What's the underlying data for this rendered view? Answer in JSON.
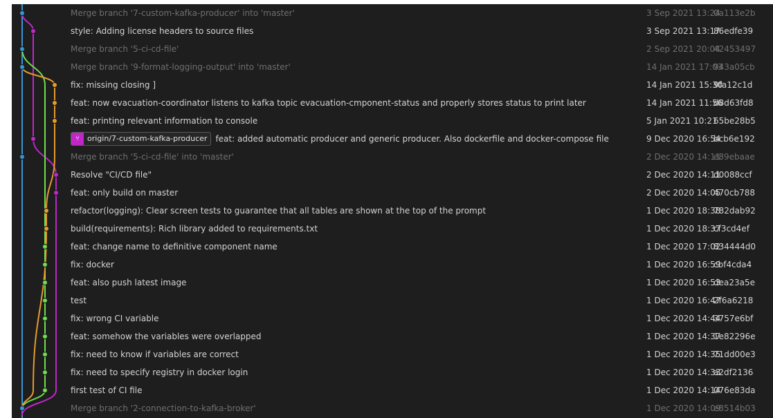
{
  "colors": {
    "blue": "#3794d6",
    "magenta": "#c026c8",
    "orange": "#e89b2c",
    "green": "#6fe04a"
  },
  "commits": [
    {
      "message": "Merge branch '7-custom-kafka-producer' into 'master'",
      "date": "3 Sep 2021 13:24",
      "hash": "0a113e2b",
      "merge": true
    },
    {
      "message": "style: Adding license headers to source files",
      "date": "3 Sep 2021 13:17",
      "hash": "86edfe39",
      "merge": false
    },
    {
      "message": "Merge branch '5-ci-cd-file'",
      "date": "2 Sep 2021 20:04",
      "hash": "42453497",
      "merge": true
    },
    {
      "message": "Merge branch '9-format-logging-output' into 'master'",
      "date": "14 Jan 2021 17:03",
      "hash": "943a05cb",
      "merge": true
    },
    {
      "message": "fix: missing closing ]",
      "date": "14 Jan 2021 15:30",
      "hash": "9fa12c1d",
      "merge": false
    },
    {
      "message": "feat: now evacuation-coordinator listens to kafka topic evacuation-cmponent-status and properly stores status to print later",
      "date": "14 Jan 2021 11:56",
      "hash": "d8d63fd8",
      "merge": false
    },
    {
      "message": "feat: printing relevant information to console",
      "date": "5 Jan 2021 10:21",
      "hash": "65be28b5",
      "merge": false
    },
    {
      "message": "feat: added automatic producer and generic producer. Also dockerfile and docker-compose file",
      "date": "9 Dec 2020 16:54",
      "hash": "bcb6e192",
      "merge": false,
      "tag": "origin/7-custom-kafka-producer"
    },
    {
      "message": "Merge branch '5-ci-cd-file' into 'master'",
      "date": "2 Dec 2020 14:11",
      "hash": "e89ebaae",
      "merge": true
    },
    {
      "message": "Resolve \"CI/CD file\"",
      "date": "2 Dec 2020 14:11",
      "hash": "d0088ccf",
      "merge": false
    },
    {
      "message": "feat: only build on master",
      "date": "2 Dec 2020 14:05",
      "hash": "470cb788",
      "merge": false
    },
    {
      "message": "refactor(logging): Clear screen tests to guarantee that all tables are shown at the top of the prompt",
      "date": "1 Dec 2020 18:38",
      "hash": "782dab92",
      "merge": false
    },
    {
      "message": "build(requirements): Rich library added to requirements.txt",
      "date": "1 Dec 2020 18:37",
      "hash": "cf3cd4ef",
      "merge": false
    },
    {
      "message": "feat: change name to definitive component name",
      "date": "1 Dec 2020 17:02",
      "hash": "834444d0",
      "merge": false
    },
    {
      "message": "fix: docker",
      "date": "1 Dec 2020 16:59",
      "hash": "cbf4cda4",
      "merge": false
    },
    {
      "message": "feat: also push latest image",
      "date": "1 Dec 2020 16:53",
      "hash": "dea23a5e",
      "merge": false
    },
    {
      "message": "test",
      "date": "1 Dec 2020 16:47",
      "hash": "2f6a6218",
      "merge": false
    },
    {
      "message": "fix: wrong CI variable",
      "date": "1 Dec 2020 14:44",
      "hash": "3757e6bf",
      "merge": false
    },
    {
      "message": "feat: somehow the variables were overlapped",
      "date": "1 Dec 2020 14:37",
      "hash": "1e82296e",
      "merge": false
    },
    {
      "message": "fix: need to know if variables are correct",
      "date": "1 Dec 2020 14:35",
      "hash": "71dd00e3",
      "merge": false
    },
    {
      "message": "fix: need to specify registry in docker login",
      "date": "1 Dec 2020 14:33",
      "hash": "a2df2136",
      "merge": false
    },
    {
      "message": "first test of CI file",
      "date": "1 Dec 2020 14:14",
      "hash": "076e83da",
      "merge": false
    },
    {
      "message": "Merge branch '2-connection-to-kafka-broker'",
      "date": "1 Dec 2020 14:09",
      "hash": "e8514b03",
      "merge": true
    }
  ]
}
